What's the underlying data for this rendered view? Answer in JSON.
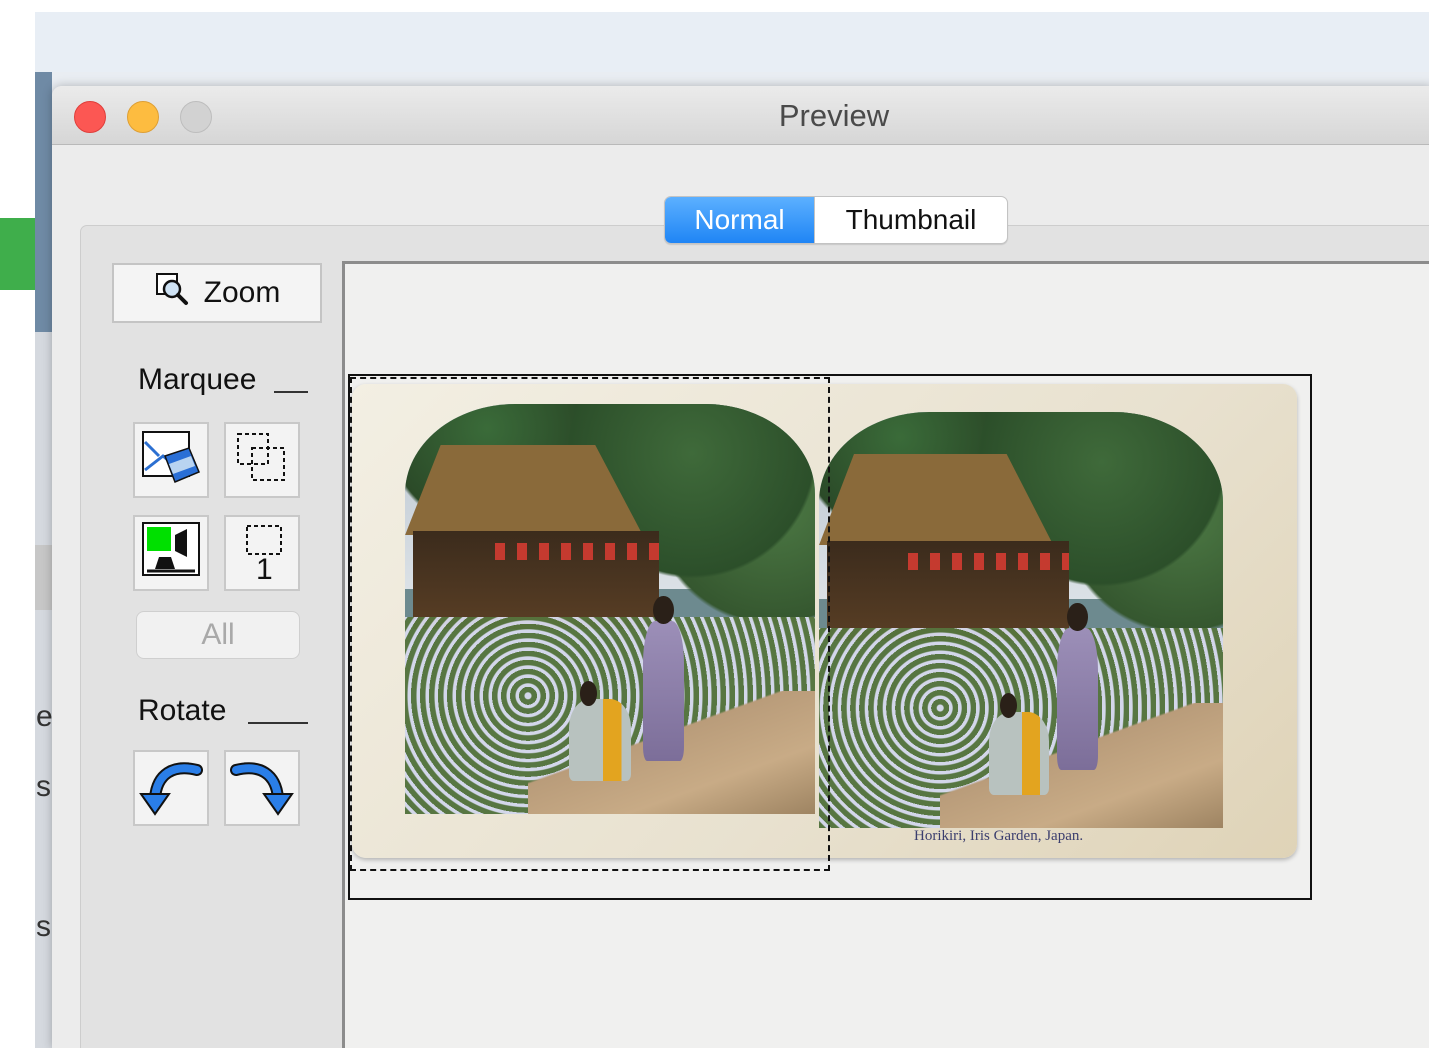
{
  "window": {
    "title": "Preview"
  },
  "view_modes": {
    "normal": "Normal",
    "thumbnail": "Thumbnail",
    "selected": "Normal"
  },
  "toolbar": {
    "zoom_label": "Zoom",
    "marquee_label": "Marquee",
    "marquee_count": "1",
    "all_label": "All",
    "rotate_label": "Rotate"
  },
  "background_app": {
    "letters": [
      "e",
      "s",
      "s"
    ]
  },
  "preview": {
    "caption": "Horikiri, Iris Garden, Japan."
  },
  "icons": {
    "zoom": "magnifier-icon",
    "auto_locate": "auto-locate-frame-icon",
    "duplicate_marquee": "duplicate-marquee-icon",
    "auto_exposure": "auto-exposure-icon",
    "marquee_frame": "marquee-frame-icon",
    "rotate_left": "rotate-left-icon",
    "rotate_right": "rotate-right-icon"
  },
  "colors": {
    "accent": "#1f85f5",
    "close": "#fc5753",
    "minimize": "#fdbc40"
  }
}
